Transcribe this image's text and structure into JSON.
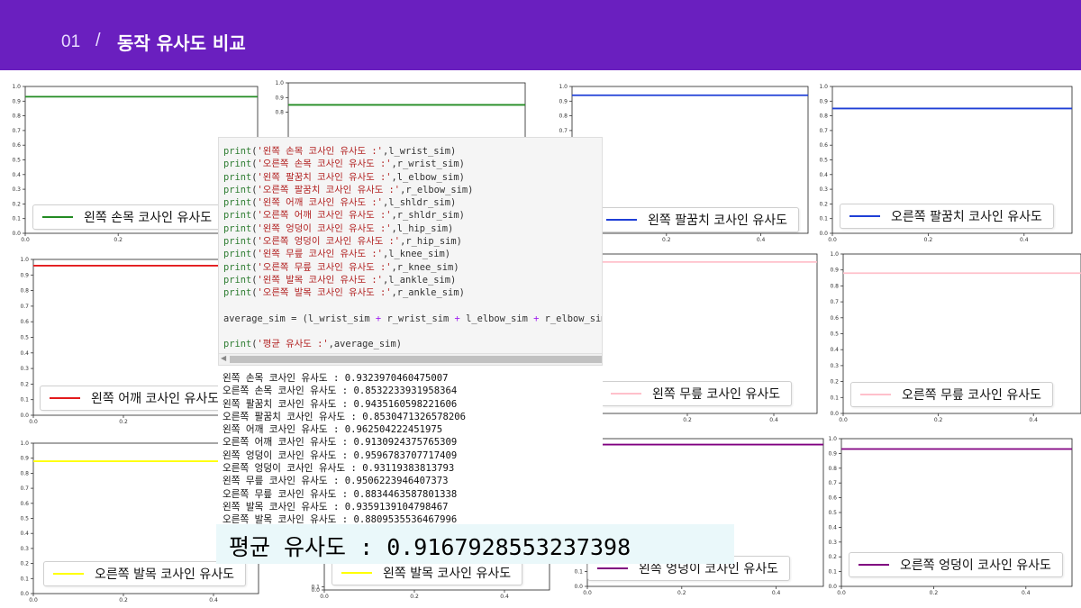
{
  "header": {
    "number": "01",
    "separator": "/",
    "title": "동작 유사도 비교"
  },
  "charts": [
    {
      "id": "c1",
      "legend": "왼쪽 손목 코사인 유사도",
      "color": "#228b22",
      "value": 0.9323970460475007,
      "xticks": [
        "0.0",
        "0.2"
      ],
      "yticks": [
        "0.0",
        "0.1",
        "0.2",
        "0.3",
        "0.4",
        "0.5",
        "0.6",
        "0.7",
        "0.8",
        "0.9",
        "1.0"
      ]
    },
    {
      "id": "c2",
      "legend": "오른쪽 손목 코사인 유사도",
      "color": "#228b22",
      "value": 0.8532233931958364,
      "xticks": [],
      "yticks": [
        "0.8",
        "0.9",
        "1.0"
      ]
    },
    {
      "id": "c3",
      "legend": "왼쪽 팔꿈치 코사인 유사도",
      "color": "#1f3fd6",
      "value": 0.9435160598221606,
      "xticks": [
        "0.2",
        "0.4"
      ],
      "yticks": [
        "0.7",
        "0.8",
        "0.9",
        "1.0"
      ]
    },
    {
      "id": "c4",
      "legend": "오른쪽 팔꿈치 코사인 유사도",
      "color": "#1f3fd6",
      "value": 0.8530471326578206,
      "xticks": [
        "0.0",
        "0.2",
        "0.4"
      ],
      "yticks": [
        "0.0",
        "0.1",
        "0.2",
        "0.3",
        "0.4",
        "0.5",
        "0.6",
        "0.7",
        "0.8",
        "0.9",
        "1.0"
      ]
    },
    {
      "id": "c5",
      "legend": "왼쪽 어깨 코사인 유사도",
      "color": "#e31a1c",
      "value": 0.962504222451975,
      "xticks": [
        "0.0",
        "0.2"
      ],
      "yticks": [
        "0.0",
        "0.1",
        "0.2",
        "0.3",
        "0.4",
        "0.5",
        "0.6",
        "0.7",
        "0.8",
        "0.9",
        "1.0"
      ]
    },
    {
      "id": "c6",
      "legend": "왼쪽 무릎 코사인 유사도",
      "color": "#ffc0cb",
      "value": 0.9506223946407373,
      "xticks": [
        "0.2",
        "0.4"
      ],
      "yticks": []
    },
    {
      "id": "c7",
      "legend": "오른쪽 무릎 코사인 유사도",
      "color": "#ffc0cb",
      "value": 0.8834463587801338,
      "xticks": [
        "0.0",
        "0.2",
        "0.4"
      ],
      "yticks": [
        "0.0",
        "0.1",
        "0.2",
        "0.3",
        "0.4",
        "0.5",
        "0.6",
        "0.7",
        "0.8",
        "0.9",
        "1.0"
      ]
    },
    {
      "id": "c8",
      "legend": "오른쪽 발목 코사인 유사도",
      "color": "#ffff00",
      "value": 0.8809535536467996,
      "xticks": [
        "0.0",
        "0.2",
        "0.4"
      ],
      "yticks": [
        "0.0",
        "0.1",
        "0.2",
        "0.3",
        "0.4",
        "0.5",
        "0.6",
        "0.7",
        "0.8",
        "0.9",
        "1.0"
      ]
    },
    {
      "id": "c9",
      "legend": "왼쪽 발목 코사인 유사도",
      "color": "#ffff00",
      "value": 0.9359139104798467,
      "xticks": [
        "0.0",
        "0.2",
        "0.4"
      ],
      "yticks": [
        "0.0",
        "0.1"
      ]
    },
    {
      "id": "c10",
      "legend": "왼쪽 엉덩이 코사인 유사도",
      "color": "#800080",
      "value": 0.9596783707717409,
      "xticks": [
        "0.0",
        "0.2",
        "0.4"
      ],
      "yticks": [
        "0.0",
        "0.1"
      ]
    },
    {
      "id": "c11",
      "legend": "오른쪽 엉덩이 코사인 유사도",
      "color": "#800080",
      "value": 0.93119383813793,
      "xticks": [
        "0.0",
        "0.2",
        "0.4"
      ],
      "yticks": [
        "0.0",
        "0.1",
        "0.2",
        "0.3",
        "0.4",
        "0.5",
        "0.6",
        "0.7",
        "0.8",
        "0.9",
        "1.0"
      ]
    }
  ],
  "chart_data": [
    {
      "type": "line",
      "series": [
        {
          "name": "왼쪽 손목 코사인 유사도",
          "values": [
            0.93,
            0.93
          ]
        }
      ],
      "ylim": [
        0,
        1.0
      ]
    },
    {
      "type": "line",
      "series": [
        {
          "name": "오른쪽 손목 코사인 유사도",
          "values": [
            0.85,
            0.85
          ]
        }
      ],
      "ylim": [
        0,
        1.0
      ]
    },
    {
      "type": "line",
      "series": [
        {
          "name": "왼쪽 팔꿈치 코사인 유사도",
          "values": [
            0.94,
            0.94
          ]
        }
      ],
      "ylim": [
        0,
        1.0
      ]
    },
    {
      "type": "line",
      "series": [
        {
          "name": "오른쪽 팔꿈치 코사인 유사도",
          "values": [
            0.85,
            0.85
          ]
        }
      ],
      "ylim": [
        0,
        1.0
      ]
    },
    {
      "type": "line",
      "series": [
        {
          "name": "왼쪽 어깨 코사인 유사도",
          "values": [
            0.96,
            0.96
          ]
        }
      ],
      "ylim": [
        0,
        1.0
      ]
    },
    {
      "type": "line",
      "series": [
        {
          "name": "왼쪽 무릎 코사인 유사도",
          "values": [
            0.95,
            0.95
          ]
        }
      ],
      "ylim": [
        0,
        1.0
      ]
    },
    {
      "type": "line",
      "series": [
        {
          "name": "오른쪽 무릎 코사인 유사도",
          "values": [
            0.88,
            0.88
          ]
        }
      ],
      "ylim": [
        0,
        1.0
      ]
    },
    {
      "type": "line",
      "series": [
        {
          "name": "오른쪽 발목 코사인 유사도",
          "values": [
            0.88,
            0.88
          ]
        }
      ],
      "ylim": [
        0,
        1.0
      ]
    },
    {
      "type": "line",
      "series": [
        {
          "name": "왼쪽 발목 코사인 유사도",
          "values": [
            0.94,
            0.94
          ]
        }
      ],
      "ylim": [
        0,
        1.0
      ]
    },
    {
      "type": "line",
      "series": [
        {
          "name": "왼쪽 엉덩이 코사인 유사도",
          "values": [
            0.96,
            0.96
          ]
        }
      ],
      "ylim": [
        0,
        1.0
      ]
    },
    {
      "type": "line",
      "series": [
        {
          "name": "오른쪽 엉덩이 코사인 유사도",
          "values": [
            0.93,
            0.93
          ]
        }
      ],
      "ylim": [
        0,
        1.0
      ]
    }
  ],
  "code": {
    "prints": [
      {
        "label": "'왼쪽 손목 코사인 유사도 :'",
        "var": "l_wrist_sim"
      },
      {
        "label": "'오른쪽 손목 코사인 유사도 :'",
        "var": "r_wrist_sim"
      },
      {
        "label": "'왼쪽 팔꿈치 코사인 유사도 :'",
        "var": "l_elbow_sim"
      },
      {
        "label": "'오른쪽 팔꿈치 코사인 유사도 :'",
        "var": "r_elbow_sim"
      },
      {
        "label": "'왼쪽 어깨 코사인 유사도 :'",
        "var": "l_shldr_sim"
      },
      {
        "label": "'오른쪽 어깨 코사인 유사도 :'",
        "var": "r_shldr_sim"
      },
      {
        "label": "'왼쪽 엉덩이 코사인 유사도 :'",
        "var": "l_hip_sim"
      },
      {
        "label": "'오른쪽 엉덩이 코사인 유사도 :'",
        "var": "r_hip_sim"
      },
      {
        "label": "'왼쪽 무릎 코사인 유사도 :'",
        "var": "l_knee_sim"
      },
      {
        "label": "'오른쪽 무릎 코사인 유사도 :'",
        "var": "r_knee_sim"
      },
      {
        "label": "'왼쪽 발목 코사인 유사도 :'",
        "var": "l_ankle_sim"
      },
      {
        "label": "'오른쪽 발목 코사인 유사도 :'",
        "var": "r_ankle_sim"
      }
    ],
    "avg_var": "average_sim",
    "avg_terms": [
      "l_wrist_sim",
      "r_wrist_sim",
      "l_elbow_sim",
      "r_elbow_sim"
    ],
    "avg_print_label": "'평균 유사도 :'",
    "print_kw": "print"
  },
  "output_lines": [
    "왼쪽 손목 코사인 유사도 : 0.9323970460475007",
    "오른쪽 손목 코사인 유사도 : 0.8532233931958364",
    "왼쪽 팔꿈치 코사인 유사도 : 0.9435160598221606",
    "오른쪽 팔꿈치 코사인 유사도 : 0.8530471326578206",
    "왼쪽 어깨 코사인 유사도 : 0.962504222451975",
    "오른쪽 어깨 코사인 유사도 : 0.9130924375765309",
    "왼쪽 엉덩이 코사인 유사도 : 0.9596783707717409",
    "오른쪽 엉덩이 코사인 유사도 : 0.93119383813793",
    "왼쪽 무릎 코사인 유사도 : 0.9506223946407373",
    "오른쪽 무릎 코사인 유사도 : 0.8834463587801338",
    "왼쪽 발목 코사인 유사도 : 0.9359139104798467",
    "오른쪽 발목 코사인 유사도 : 0.8809535536467996"
  ],
  "average": "평균 유사도 : 0.9167928553237398"
}
